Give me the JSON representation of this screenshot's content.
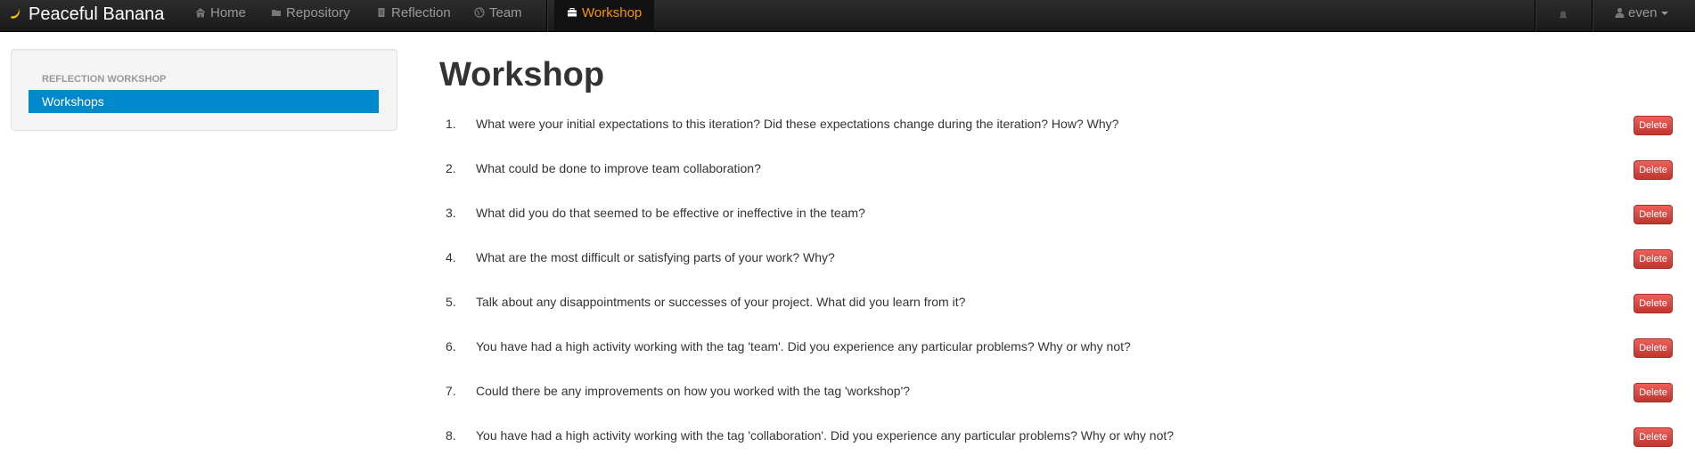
{
  "navbar": {
    "brand": "Peaceful Banana",
    "items": [
      {
        "label": "Home",
        "icon": "home-icon"
      },
      {
        "label": "Repository",
        "icon": "folder-icon"
      },
      {
        "label": "Reflection",
        "icon": "document-icon"
      },
      {
        "label": "Team",
        "icon": "globe-icon"
      },
      {
        "label": "Workshop",
        "icon": "briefcase-icon",
        "active": true
      }
    ],
    "user": "even",
    "active_color": "#f89406"
  },
  "sidebar": {
    "header": "Reflection Workshop",
    "items": [
      {
        "label": "Workshops",
        "active": true
      }
    ],
    "active_color": "#0088cc"
  },
  "main": {
    "title": "Workshop",
    "delete_label": "Delete",
    "questions": [
      {
        "num": "1.",
        "text": "What were your initial expectations to this iteration? Did these expectations change during the iteration? How? Why?"
      },
      {
        "num": "2.",
        "text": "What could be done to improve team collaboration?"
      },
      {
        "num": "3.",
        "text": "What did you do that seemed to be effective or ineffective in the team?"
      },
      {
        "num": "4.",
        "text": "What are the most difficult or satisfying parts of your work? Why?"
      },
      {
        "num": "5.",
        "text": "Talk about any disappointments or successes of your project. What did you learn from it?"
      },
      {
        "num": "6.",
        "text": "You have had a high activity working with the tag 'team'. Did you experience any particular problems? Why or why not?"
      },
      {
        "num": "7.",
        "text": "Could there be any improvements on how you worked with the tag 'workshop'?"
      },
      {
        "num": "8.",
        "text": "You have had a high activity working with the tag 'collaboration'. Did you experience any particular problems? Why or why not?"
      }
    ],
    "delete_color": "#da4f49"
  }
}
